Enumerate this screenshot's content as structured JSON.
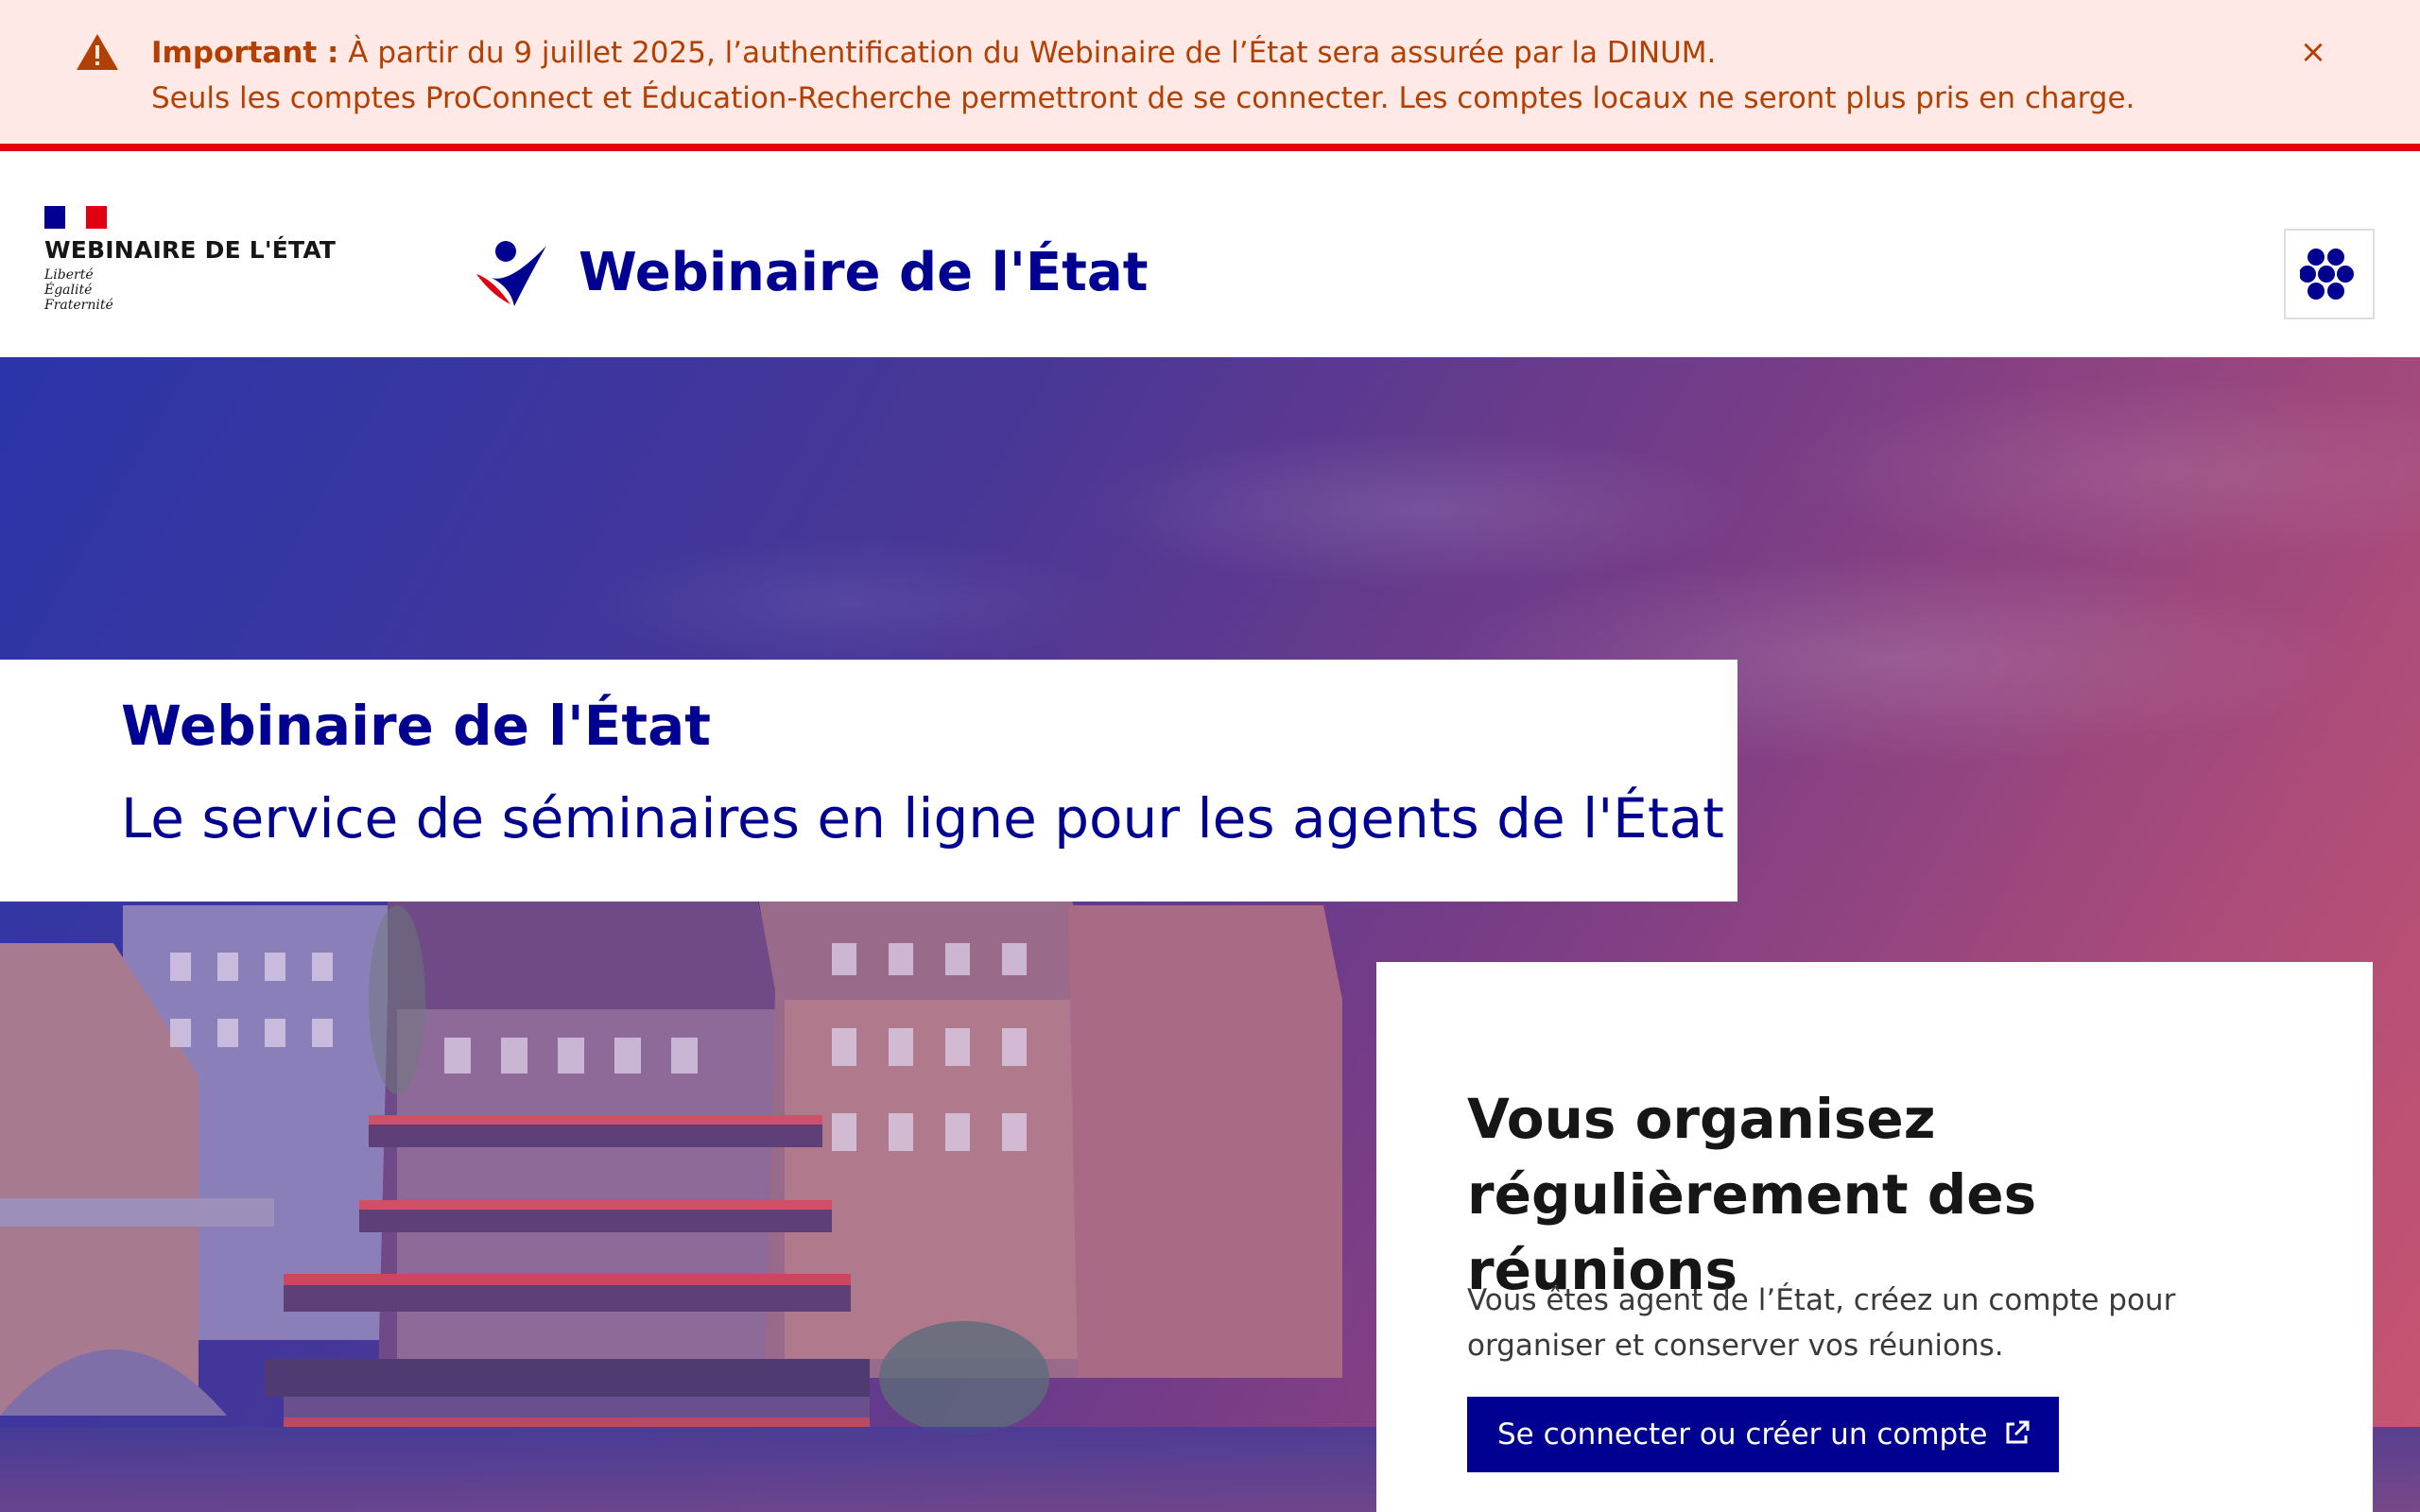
{
  "notice": {
    "label": "Important :",
    "line1": "À partir du 9 juillet 2025, l’authentification du Webinaire de l’État sera assurée par la DINUM.",
    "line2": "Seuls les comptes ProConnect et Éducation-Recherche permettront de se connecter. Les comptes locaux ne seront plus pris en charge.",
    "close_label": "×",
    "icon": "warning-icon",
    "color": "#b34000",
    "background": "#ffe9e6",
    "border_color": "#e1000f"
  },
  "header": {
    "operator_name": "WEBINAIRE DE L'ÉTAT",
    "devise": [
      "Liberté",
      "Égalité",
      "Fraternité"
    ],
    "service_title": "Webinaire de l'État",
    "apps_icon": "apps-grid-icon",
    "brand_color": "#000091"
  },
  "hero": {
    "title": "Webinaire de l'État",
    "subtitle": "Le service de séminaires en ligne pour les agents de l'État",
    "card": {
      "heading": "Vous organisez régulièrement des réunions",
      "text": "Vous êtes agent de l’État, créez un compte pour organiser et conserver vos réunions.",
      "button_label": "Se connecter ou créer un compte",
      "button_icon": "external-link-icon"
    }
  }
}
